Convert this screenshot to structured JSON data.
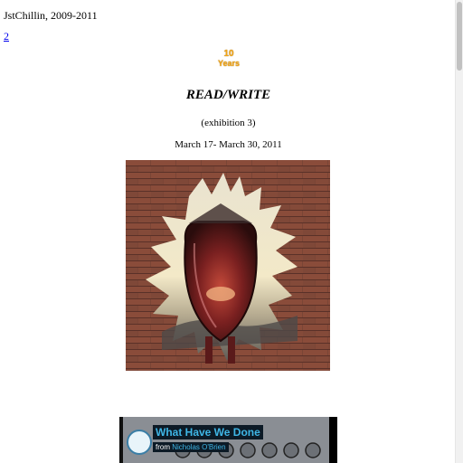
{
  "site": {
    "title": "JstChillin, 2009-2011",
    "page_link": "2"
  },
  "badge": {
    "number": "10",
    "word": "Years"
  },
  "exhibition": {
    "title": "READ/WRITE",
    "subtitle": "(exhibition 3)",
    "dates": "March 17- March 30, 2011"
  },
  "video": {
    "title": "What Have We Done",
    "by_prefix": "from",
    "author": "Nicholas O'Brien"
  }
}
